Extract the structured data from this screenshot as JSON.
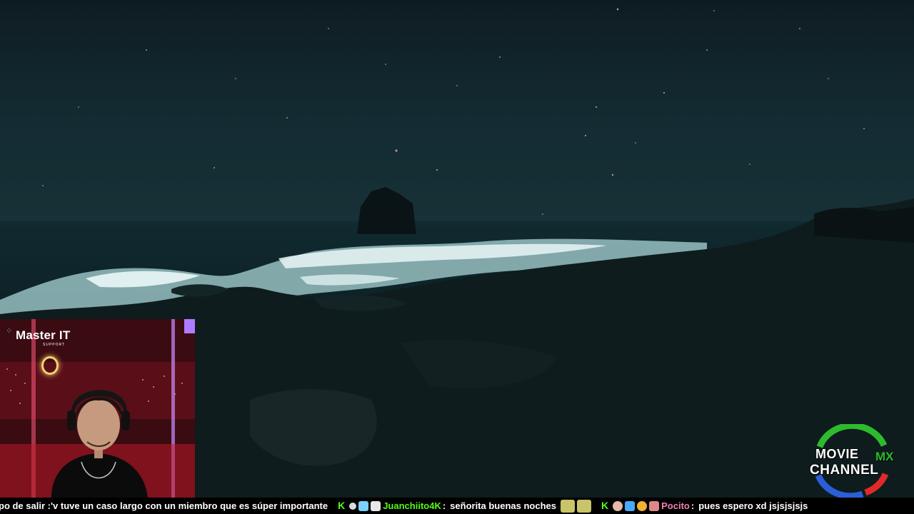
{
  "webcam": {
    "sponsor_brand": "Master IT",
    "sponsor_sub": "SUPPORT"
  },
  "channel_logo": {
    "line1": "MOVIE",
    "line2": "CHANNEL",
    "suffix": "MX",
    "colors": {
      "green": "#2dbb2d",
      "red": "#e02a2a",
      "blue": "#2a5fd9"
    }
  },
  "chat_ticker": {
    "messages": [
      {
        "text": "po de salir :'v  tuve un caso largo con un miembro que es súper importante",
        "user": ""
      },
      {
        "user": "Juanchiito4K",
        "separator": ":",
        "text": "señorita buenas noches",
        "user_color": "#53fc18"
      },
      {
        "user": "Pocito",
        "separator": ":",
        "text": "pues espero xd jsjsjsjsjs",
        "user_color": "#f47fb4"
      }
    ],
    "kick_icon": "K"
  },
  "icons": [
    "kick-icon",
    "emote-icon",
    "badge-icon"
  ]
}
